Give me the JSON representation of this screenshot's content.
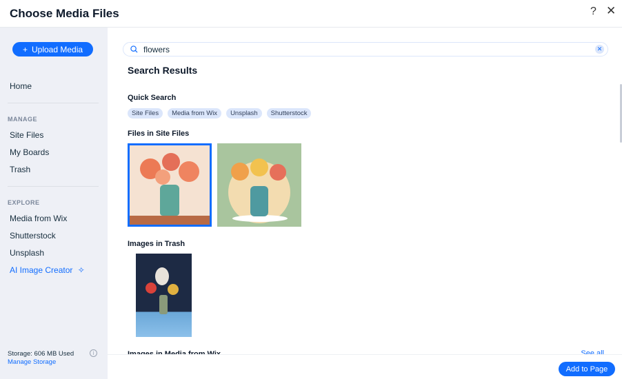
{
  "header": {
    "title": "Choose Media Files",
    "help_icon": "question-icon",
    "close_icon": "close-icon"
  },
  "sidebar": {
    "upload_label": "Upload Media",
    "home": "Home",
    "manage_title": "MANAGE",
    "manage_items": [
      "Site Files",
      "My Boards",
      "Trash"
    ],
    "explore_title": "EXPLORE",
    "explore_items": [
      "Media from Wix",
      "Shutterstock",
      "Unsplash"
    ],
    "ai_creator": "AI Image Creator",
    "storage": "Storage: 606 MB Used",
    "manage_storage": "Manage Storage"
  },
  "main": {
    "search_value": "flowers",
    "results_title": "Search Results",
    "quick_search_title": "Quick Search",
    "chips": [
      "Site Files",
      "Media from Wix",
      "Unsplash",
      "Shutterstock"
    ],
    "site_files_title": "Files in Site Files",
    "trash_title": "Images in Trash",
    "wix_title": "Images in Media from Wix",
    "see_all": "See all",
    "add_to_page": "Add to Page"
  },
  "colors": {
    "accent": "#116dff",
    "sidebar_bg": "#eef0f6",
    "chip_bg": "#dbe6fb"
  }
}
